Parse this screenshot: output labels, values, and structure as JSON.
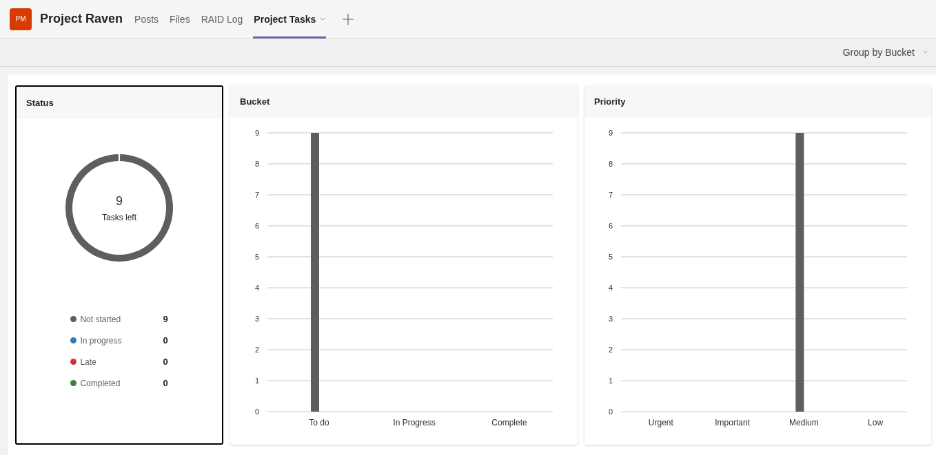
{
  "app": {
    "badge": "PM",
    "title": "Project Raven"
  },
  "tabs": [
    {
      "label": "Posts",
      "selected": false,
      "dropdown": false
    },
    {
      "label": "Files",
      "selected": false,
      "dropdown": false
    },
    {
      "label": "RAID Log",
      "selected": false,
      "dropdown": false
    },
    {
      "label": "Project Tasks",
      "selected": true,
      "dropdown": true
    }
  ],
  "toolbar": {
    "group_by": "Group by Bucket"
  },
  "status": {
    "title": "Status",
    "center_value": "9",
    "center_label": "Tasks left",
    "legend": [
      {
        "label": "Not started",
        "count": "9",
        "color": "#605e5c"
      },
      {
        "label": "In progress",
        "count": "0",
        "color": "#2f7dbd"
      },
      {
        "label": "Late",
        "count": "0",
        "color": "#d13438"
      },
      {
        "label": "Completed",
        "count": "0",
        "color": "#3c7f3c"
      }
    ]
  },
  "bucket": {
    "title": "Bucket",
    "chart_data": {
      "type": "bar",
      "categories": [
        "To do",
        "In Progress",
        "Complete"
      ],
      "series": [
        {
          "color": "#605e5c",
          "values": [
            9,
            0,
            0
          ]
        }
      ],
      "ylim": [
        0,
        9
      ],
      "yticks": [
        0,
        1,
        2,
        3,
        4,
        5,
        6,
        7,
        8,
        9
      ],
      "grid": true
    }
  },
  "priority": {
    "title": "Priority",
    "chart_data": {
      "type": "bar",
      "categories": [
        "Urgent",
        "Important",
        "Medium",
        "Low"
      ],
      "series": [
        {
          "color": "#605e5c",
          "values": [
            0,
            0,
            9,
            0
          ]
        }
      ],
      "ylim": [
        0,
        9
      ],
      "yticks": [
        0,
        1,
        2,
        3,
        4,
        5,
        6,
        7,
        8,
        9
      ],
      "grid": true
    }
  }
}
